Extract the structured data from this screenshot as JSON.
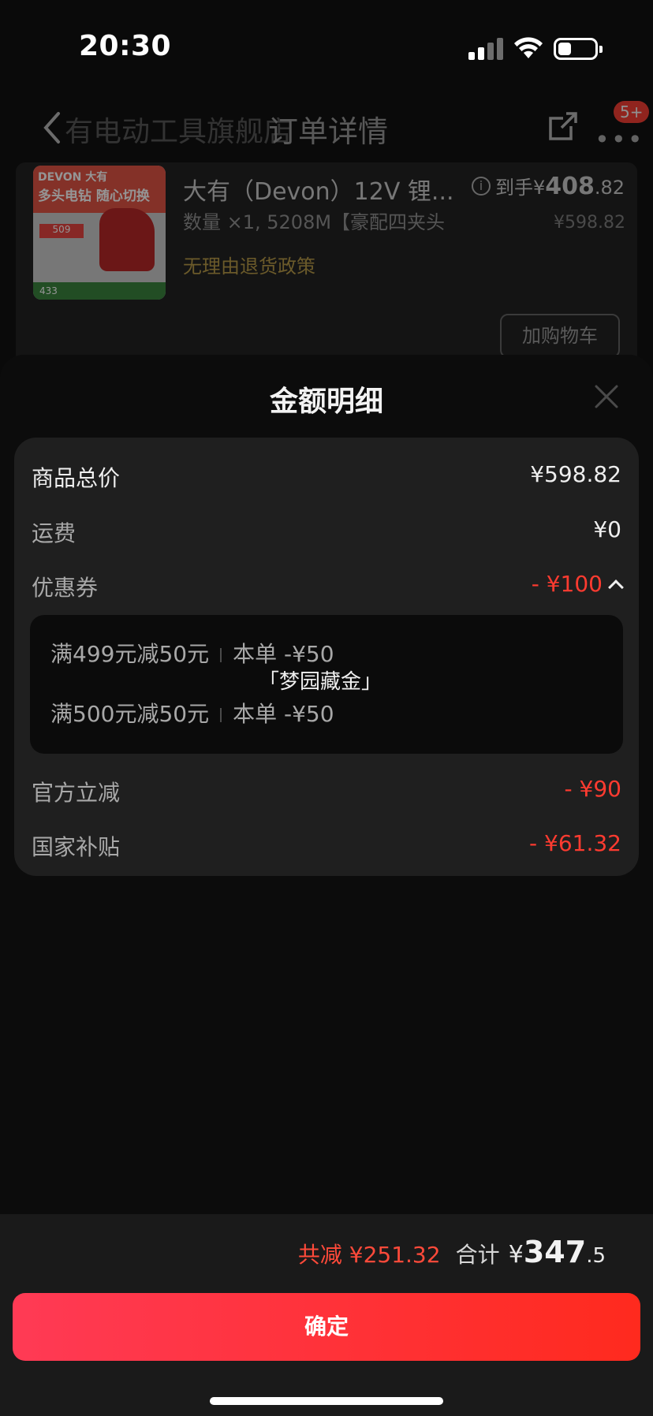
{
  "status_bar": {
    "time": "20:30"
  },
  "nav": {
    "shop_name": "有电动工具旗舰店",
    "title": "订单详情",
    "more_badge": "5+"
  },
  "order": {
    "thumb": {
      "brand": "DEVON 大有",
      "headline": "多头电钻 随心切换",
      "price_tag": "509",
      "footer": "433"
    },
    "product_name": "大有（Devon）12V 锂...",
    "quantity_spec": "数量 ×1, 5208M【豪配四夹头",
    "policy": "无理由退货政策",
    "price_label": "到手¥",
    "price_main": "408",
    "price_decimal": ".82",
    "price_original": "¥598.82",
    "add_to_cart": "加购物车"
  },
  "sheet": {
    "title": "金额明细",
    "rows": {
      "total_price": {
        "label": "商品总价",
        "value": "¥598.82"
      },
      "shipping": {
        "label": "运费",
        "value": "¥0"
      },
      "coupon": {
        "label": "优惠券",
        "value": "- ¥100"
      },
      "official_discount": {
        "label": "官方立减",
        "value": "- ¥90"
      },
      "national_subsidy": {
        "label": "国家补贴",
        "value": "- ¥61.32"
      }
    },
    "coupons": [
      {
        "rule": "满499元减50元",
        "applied": "本单 -¥50",
        "name": "「梦园藏金」"
      },
      {
        "rule": "满500元减50元",
        "applied": "本单 -¥50"
      }
    ]
  },
  "footer": {
    "saving": "共减 ¥251.32",
    "total_label": "合计",
    "total_currency": "¥",
    "total_int": "347",
    "total_dec": ".5",
    "confirm": "确定"
  },
  "colors": {
    "accent_red": "#ff3b30",
    "button_start": "#ff3a55",
    "button_end": "#ff2a1e"
  }
}
